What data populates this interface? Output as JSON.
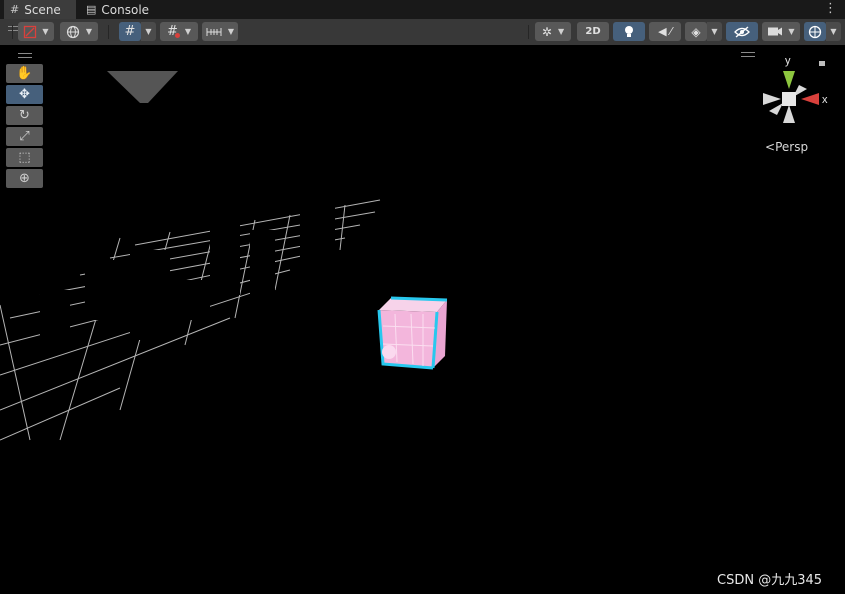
{
  "tabs": [
    {
      "label": "Scene",
      "icon": "grid-icon",
      "active": true
    },
    {
      "label": "Console",
      "icon": "console-icon",
      "active": false
    }
  ],
  "toolbar": {
    "toggle_2d_label": "2D",
    "draw_mode_icon": "shading-mode-icon",
    "global_icon": "globe-icon",
    "grid_snap_icon": "grid-snap-icon",
    "grid_visibility_icon": "grid-visibility-icon",
    "increment_snap_icon": "ruler-icon",
    "gizmos_icon": "bug-icon",
    "lighting_icon": "lightbulb-icon",
    "audio_icon": "speaker-muted-icon",
    "effects_icon": "layers-icon",
    "hidden_icon": "eye-hidden-icon",
    "camera_icon": "camera-icon",
    "gizmo_toggle_icon": "gizmo-icon"
  },
  "tools": [
    {
      "name": "hand",
      "icon": "hand-icon",
      "active": false
    },
    {
      "name": "move",
      "icon": "move-icon",
      "active": true
    },
    {
      "name": "rotate",
      "icon": "rotate-icon",
      "active": false
    },
    {
      "name": "scale",
      "icon": "scale-icon",
      "active": false
    },
    {
      "name": "rect",
      "icon": "rect-icon",
      "active": false
    },
    {
      "name": "transform",
      "icon": "transform-icon",
      "active": false
    }
  ],
  "orientation_gizmo": {
    "y_label": "y",
    "x_label": "x",
    "projection_label": "Persp",
    "colors": {
      "y": "#8dc63f",
      "x": "#d9413c",
      "neutral": "#d8d8d8"
    }
  },
  "scene": {
    "cube_colors": {
      "face": "#f4b8dc",
      "edge": "#28c8ee"
    }
  },
  "watermark": "CSDN @九九345"
}
